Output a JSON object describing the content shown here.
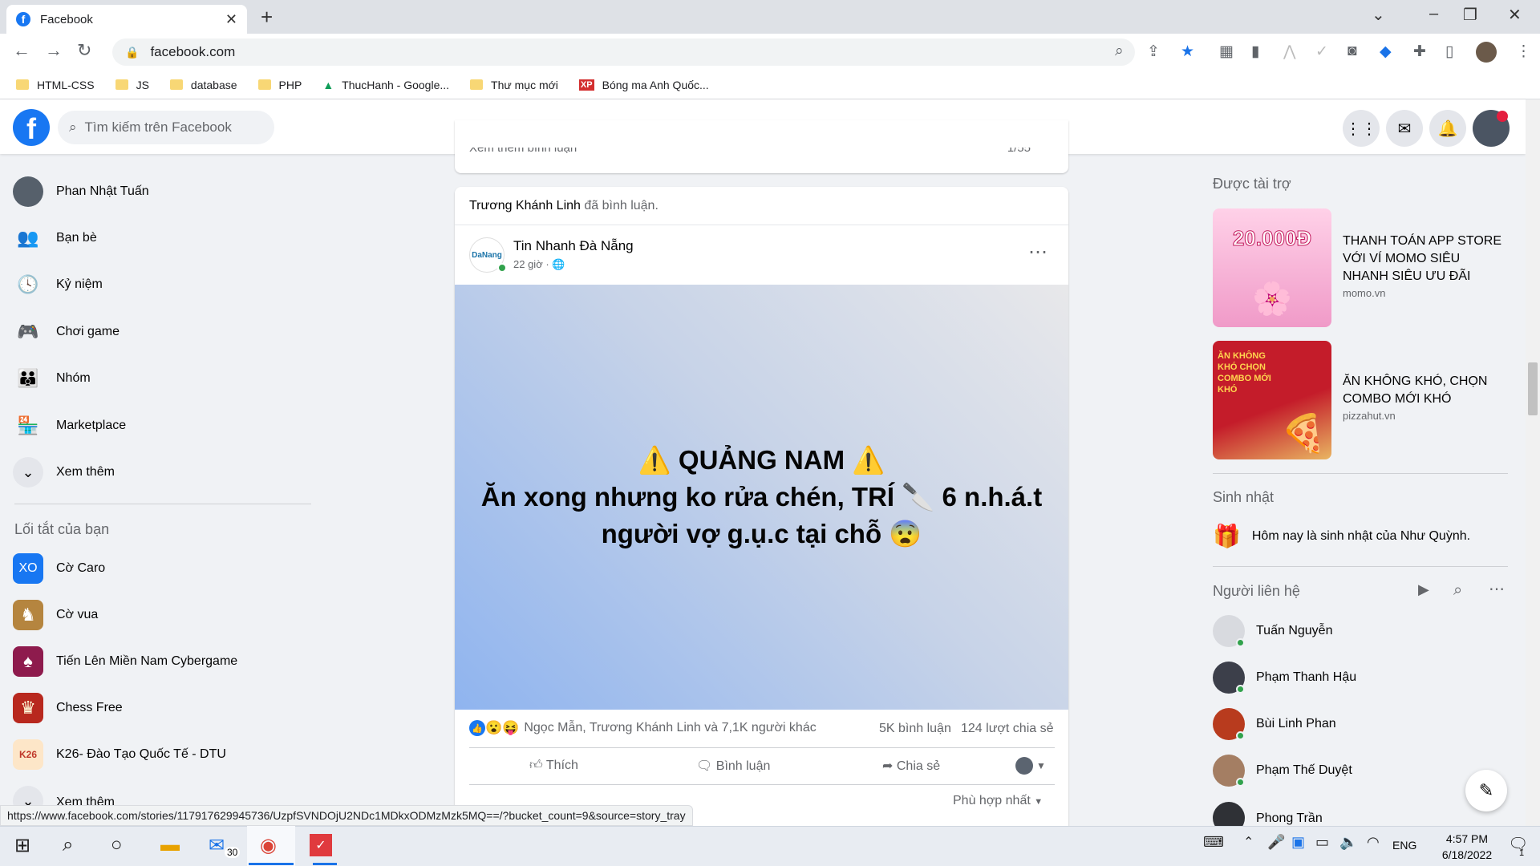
{
  "browser": {
    "tab_title": "Facebook",
    "url": "facebook.com",
    "bookmarks": [
      "HTML-CSS",
      "JS",
      "database",
      "PHP",
      "ThucHanh - Google...",
      "Thư mục mới",
      "Bóng ma Anh Quốc..."
    ],
    "status_url": "https://www.facebook.com/stories/117917629945736/UzpfSVNDOjU2NDc1MDkxODMzMzk5MQ==/?bucket_count=9&source=story_tray"
  },
  "header": {
    "search_placeholder": "Tìm kiếm trên Facebook",
    "nav": [
      "home",
      "marketplace",
      "groups",
      "gaming"
    ]
  },
  "left": {
    "items": [
      {
        "label": "Phan Nhật Tuấn",
        "icon": "avatar"
      },
      {
        "label": "Bạn bè",
        "icon": "friends-icon"
      },
      {
        "label": "Kỷ niệm",
        "icon": "memories-icon"
      },
      {
        "label": "Chơi game",
        "icon": "gaming-icon"
      },
      {
        "label": "Nhóm",
        "icon": "groups-icon"
      },
      {
        "label": "Marketplace",
        "icon": "marketplace-icon"
      },
      {
        "label": "Xem thêm",
        "icon": "chevron-down-icon"
      }
    ],
    "shortcuts_title": "Lối tắt của bạn",
    "shortcuts": [
      "Cờ Caro",
      "Cờ vua",
      "Tiến Lên Miền Nam Cybergame",
      "Chess Free",
      "K26- Đào Tạo Quốc Tế - DTU",
      "Xem thêm"
    ]
  },
  "feed": {
    "prev_more": "Xem thêm bình luận",
    "prev_count": "1/55",
    "commenter": "Trương Khánh Linh",
    "comment_action": "đã bình luận.",
    "page_name": "Tin Nhanh Đà Nẵng",
    "post_time": "22 giờ ·",
    "post_line1": "⚠️ QUẢNG NAM ⚠️",
    "post_line2": "Ăn xong nhưng ko rửa chén, TRÍ 🔪 6 n.h.á.t",
    "post_line3": "người vợ g.ụ.c tại chỗ 😨",
    "reactions_text": "Ngọc Mẫn, Trương Khánh Linh và 7,1K người khác",
    "comments_count": "5K bình luận",
    "shares_count": "124 lượt chia sẻ",
    "like_label": "Thích",
    "comment_label": "Bình luận",
    "share_label": "Chia sẻ",
    "sort_label": "Phù hợp nhất"
  },
  "right": {
    "sponsored_title": "Được tài trợ",
    "ads": [
      {
        "title": "THANH TOÁN APP STORE VỚI VÍ MOMO SIÊU NHANH SIÊU ƯU ĐÃI",
        "domain": "momo.vn",
        "img_text": "20.000Đ"
      },
      {
        "title": "ĂN KHÔNG KHÓ, CHỌN COMBO MỚI KHÓ",
        "domain": "pizzahut.vn",
        "img_text": "ĂN KHÔNG KHÓ CHỌN COMBO MỚI KHÓ"
      }
    ],
    "birthday_title": "Sinh nhật",
    "birthday_text": "Hôm nay là sinh nhật của",
    "birthday_name": "Như Quỳnh.",
    "contacts_title": "Người liên hệ",
    "contacts": [
      "Tuấn Nguyễn",
      "Phạm Thanh Hậu",
      "Bùi Linh Phan",
      "Phạm Thế Duyệt",
      "Phong Trần"
    ]
  },
  "taskbar": {
    "mail_badge": "30",
    "lang": "ENG",
    "time": "4:57 PM",
    "date": "6/18/2022",
    "notif_badge": "1"
  },
  "colors": {
    "fb_blue": "#1877f2",
    "bg": "#f0f2f5",
    "online": "#31a24c"
  }
}
